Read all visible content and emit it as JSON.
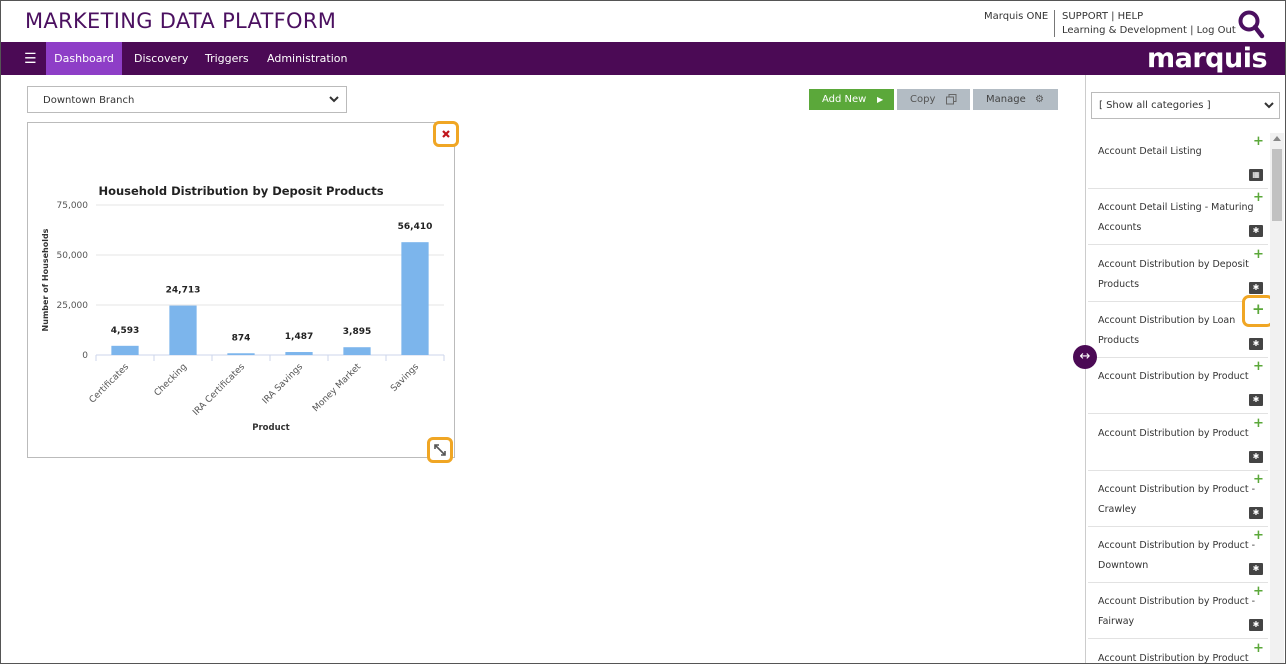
{
  "header": {
    "title": "MARKETING DATA PLATFORM",
    "user_link": "Marquis ONE",
    "support": "SUPPORT | HELP",
    "learning": "Learning & Development | Log Out"
  },
  "nav": {
    "menu_icon": "hamburger-icon",
    "items": [
      {
        "label": "Dashboard",
        "active": true
      },
      {
        "label": "Discovery",
        "active": false
      },
      {
        "label": "Triggers",
        "active": false
      },
      {
        "label": "Administration",
        "active": false
      }
    ],
    "brand": "marquis"
  },
  "toolbar": {
    "branch_value": "Downtown Branch",
    "add_new": "Add New",
    "copy": "Copy",
    "manage": "Manage"
  },
  "colors": {
    "brand_purple": "#4b0a55",
    "active_tab": "#8e3ec7",
    "add_green": "#5ba83a",
    "bar_blue": "#7cb5ec",
    "highlight": "#f0a624"
  },
  "chart_data": {
    "type": "bar",
    "title": "Household Distribution by Deposit Products",
    "xlabel": "Product",
    "ylabel": "Number of Households",
    "categories": [
      "Certificates",
      "Checking",
      "IRA Certificates",
      "IRA Savings",
      "Money Market",
      "Savings"
    ],
    "values": [
      4593,
      24713,
      874,
      1487,
      3895,
      56410
    ],
    "value_labels": [
      "4,593",
      "24,713",
      "874",
      "1,487",
      "3,895",
      "56,410"
    ],
    "ylim": [
      0,
      75000
    ],
    "yticks": [
      0,
      25000,
      50000,
      75000
    ],
    "ytick_labels": [
      "0",
      "25,000",
      "50,000",
      "75,000"
    ],
    "grid": true,
    "legend": "none"
  },
  "panel": {
    "category_select": "[ Show all categories ]",
    "items": [
      {
        "label": "Account Detail Listing",
        "type_icon": "table-icon"
      },
      {
        "label": "Account Detail Listing - Maturing Accounts",
        "type_icon": "chart-icon"
      },
      {
        "label": "Account Distribution by Deposit Products",
        "type_icon": "chart-icon"
      },
      {
        "label": "Account Distribution by Loan Products",
        "type_icon": "chart-icon"
      },
      {
        "label": "Account Distribution by Product",
        "type_icon": "chart-icon"
      },
      {
        "label": "Account Distribution by Product",
        "type_icon": "chart-icon"
      },
      {
        "label": "Account Distribution by Product - Crawley",
        "type_icon": "chart-icon"
      },
      {
        "label": "Account Distribution by Product - Downtown",
        "type_icon": "chart-icon"
      },
      {
        "label": "Account Distribution by Product - Fairway",
        "type_icon": "chart-icon"
      },
      {
        "label": "Account Distribution by Product",
        "type_icon": "chart-icon"
      }
    ]
  }
}
